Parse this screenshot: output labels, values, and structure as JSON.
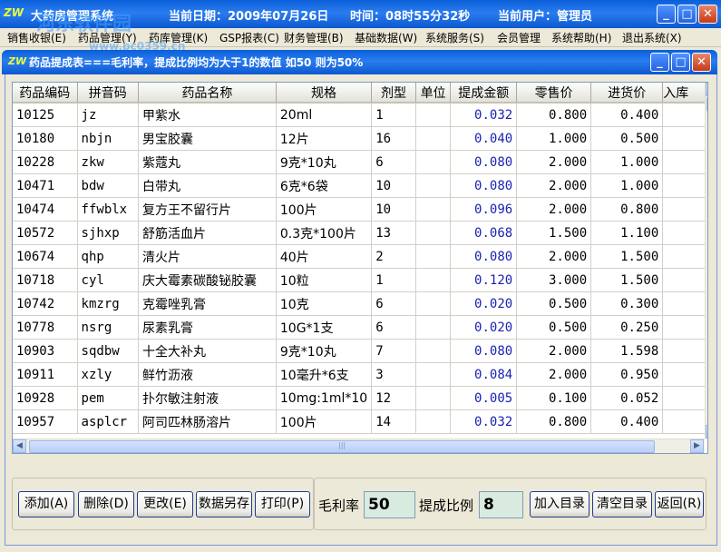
{
  "app": {
    "title": "大药房管理系统",
    "date_label": "当前日期：2009年07月26日",
    "time_label": "时间：08时55分32秒",
    "user_label": "当前用户：管理员",
    "watermark_main": "河东软件园",
    "watermark_url": "www.pc0359.cn"
  },
  "menu": [
    "销售收银(E)",
    "药品管理(Y)",
    "药库管理(K)",
    "GSP报表(C)",
    "财务管理(B)",
    "基础数据(W)",
    "系统服务(S)",
    "会员管理",
    "系统帮助(H)",
    "退出系统(X)"
  ],
  "window": {
    "title": "药品提成表===毛利率，提成比例均为大于1的数值  如50 则为50%"
  },
  "table": {
    "columns": [
      "药品编码",
      "拼音码",
      "药品名称",
      "规格",
      "剂型",
      "单位",
      "提成金额",
      "零售价",
      "进货价",
      "入库"
    ],
    "rows": [
      [
        "10125",
        "jz",
        "甲紫水",
        "20ml",
        "1",
        "",
        "0.032",
        "0.800",
        "0.400"
      ],
      [
        "10180",
        "nbjn",
        "男宝胶囊",
        "12片",
        "16",
        "",
        "0.040",
        "1.000",
        "0.500"
      ],
      [
        "10228",
        "zkw",
        "紫蔻丸",
        "9克*10丸",
        "6",
        "",
        "0.080",
        "2.000",
        "1.000"
      ],
      [
        "10471",
        "bdw",
        "白带丸",
        "6克*6袋",
        "10",
        "",
        "0.080",
        "2.000",
        "1.000"
      ],
      [
        "10474",
        "ffwblx",
        "复方王不留行片",
        "100片",
        "10",
        "",
        "0.096",
        "2.000",
        "0.800"
      ],
      [
        "10572",
        "sjhxp",
        "舒筋活血片",
        "0.3克*100片",
        "13",
        "",
        "0.068",
        "1.500",
        "1.100"
      ],
      [
        "10674",
        "qhp",
        "清火片",
        "40片",
        "2",
        "",
        "0.080",
        "2.000",
        "1.500"
      ],
      [
        "10718",
        "cyl",
        "庆大霉素碳酸铋胶囊",
        "10粒",
        "1",
        "",
        "0.120",
        "3.000",
        "1.500"
      ],
      [
        "10742",
        "kmzrg",
        "克霉唑乳膏",
        "10克",
        "6",
        "",
        "0.020",
        "0.500",
        "0.300"
      ],
      [
        "10778",
        "nsrg",
        "尿素乳膏",
        "10G*1支",
        "6",
        "",
        "0.020",
        "0.500",
        "0.250"
      ],
      [
        "10903",
        "sqdbw",
        "十全大补丸",
        "9克*10丸",
        "7",
        "",
        "0.080",
        "2.000",
        "1.598"
      ],
      [
        "10911",
        "xzly",
        "鲜竹沥液",
        "10毫升*6支",
        "3",
        "",
        "0.084",
        "2.000",
        "0.950"
      ],
      [
        "10928",
        "pem",
        "扑尔敏注射液",
        "10mg:1ml*10",
        "12",
        "",
        "0.005",
        "0.100",
        "0.052"
      ],
      [
        "10957",
        "asplcr",
        "阿司匹林肠溶片",
        "100片",
        "14",
        "",
        "0.032",
        "0.800",
        "0.400"
      ]
    ]
  },
  "buttons": {
    "add": "添加(A)",
    "delete": "删除(D)",
    "edit": "更改(E)",
    "save_as": "数据另存",
    "print": "打印(P)",
    "add_catalog": "加入目录",
    "clear_catalog": "清空目录",
    "back": "返回(R)"
  },
  "fields": {
    "margin_label": "毛利率",
    "margin_value": "50",
    "ratio_label": "提成比例",
    "ratio_value": "8"
  },
  "colors": {
    "titlebar": "#0a5fd8",
    "amount_text": "#1a22b0",
    "input_bg": "#d9eadf"
  }
}
